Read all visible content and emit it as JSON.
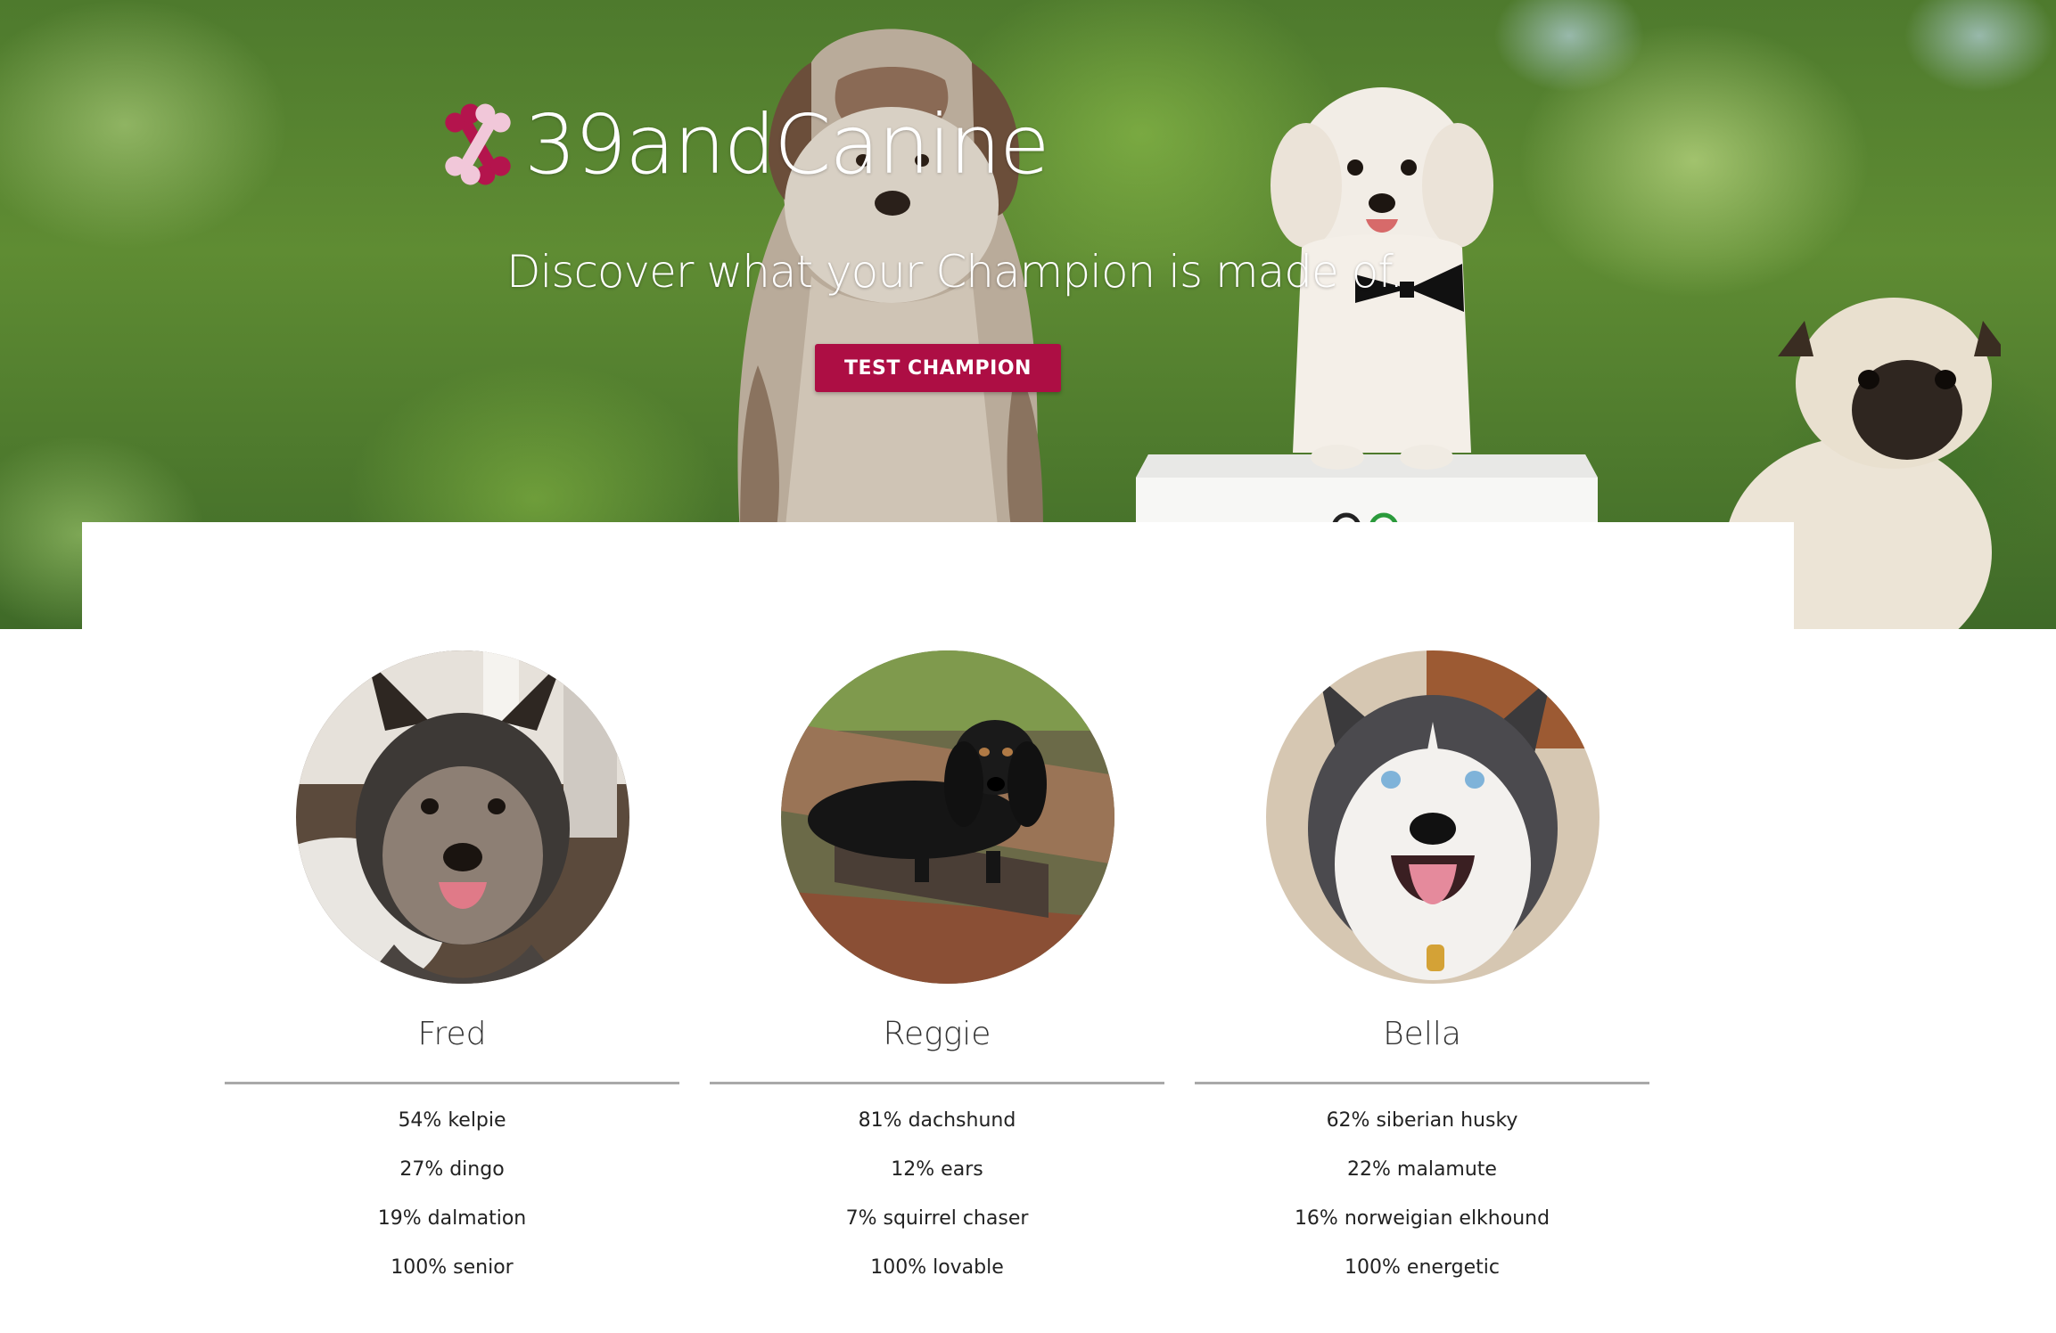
{
  "brand": {
    "title": "39andCanine",
    "icon": "bone-icon",
    "accent": "#ad0e44"
  },
  "hero": {
    "tagline": "Discover what your Champion is made of.",
    "cta_label": "TEST CHAMPION"
  },
  "dogs": [
    {
      "name": "Fred",
      "stats": [
        "54% kelpie",
        "27% dingo",
        "19% dalmation",
        "100% senior"
      ]
    },
    {
      "name": "Reggie",
      "stats": [
        "81% dachshund",
        "12% ears",
        "7% squirrel chaser",
        "100% lovable"
      ]
    },
    {
      "name": "Bella",
      "stats": [
        "62% siberian husky",
        "22% malamute",
        "16% norweigian elkhound",
        "100% energetic"
      ]
    }
  ]
}
